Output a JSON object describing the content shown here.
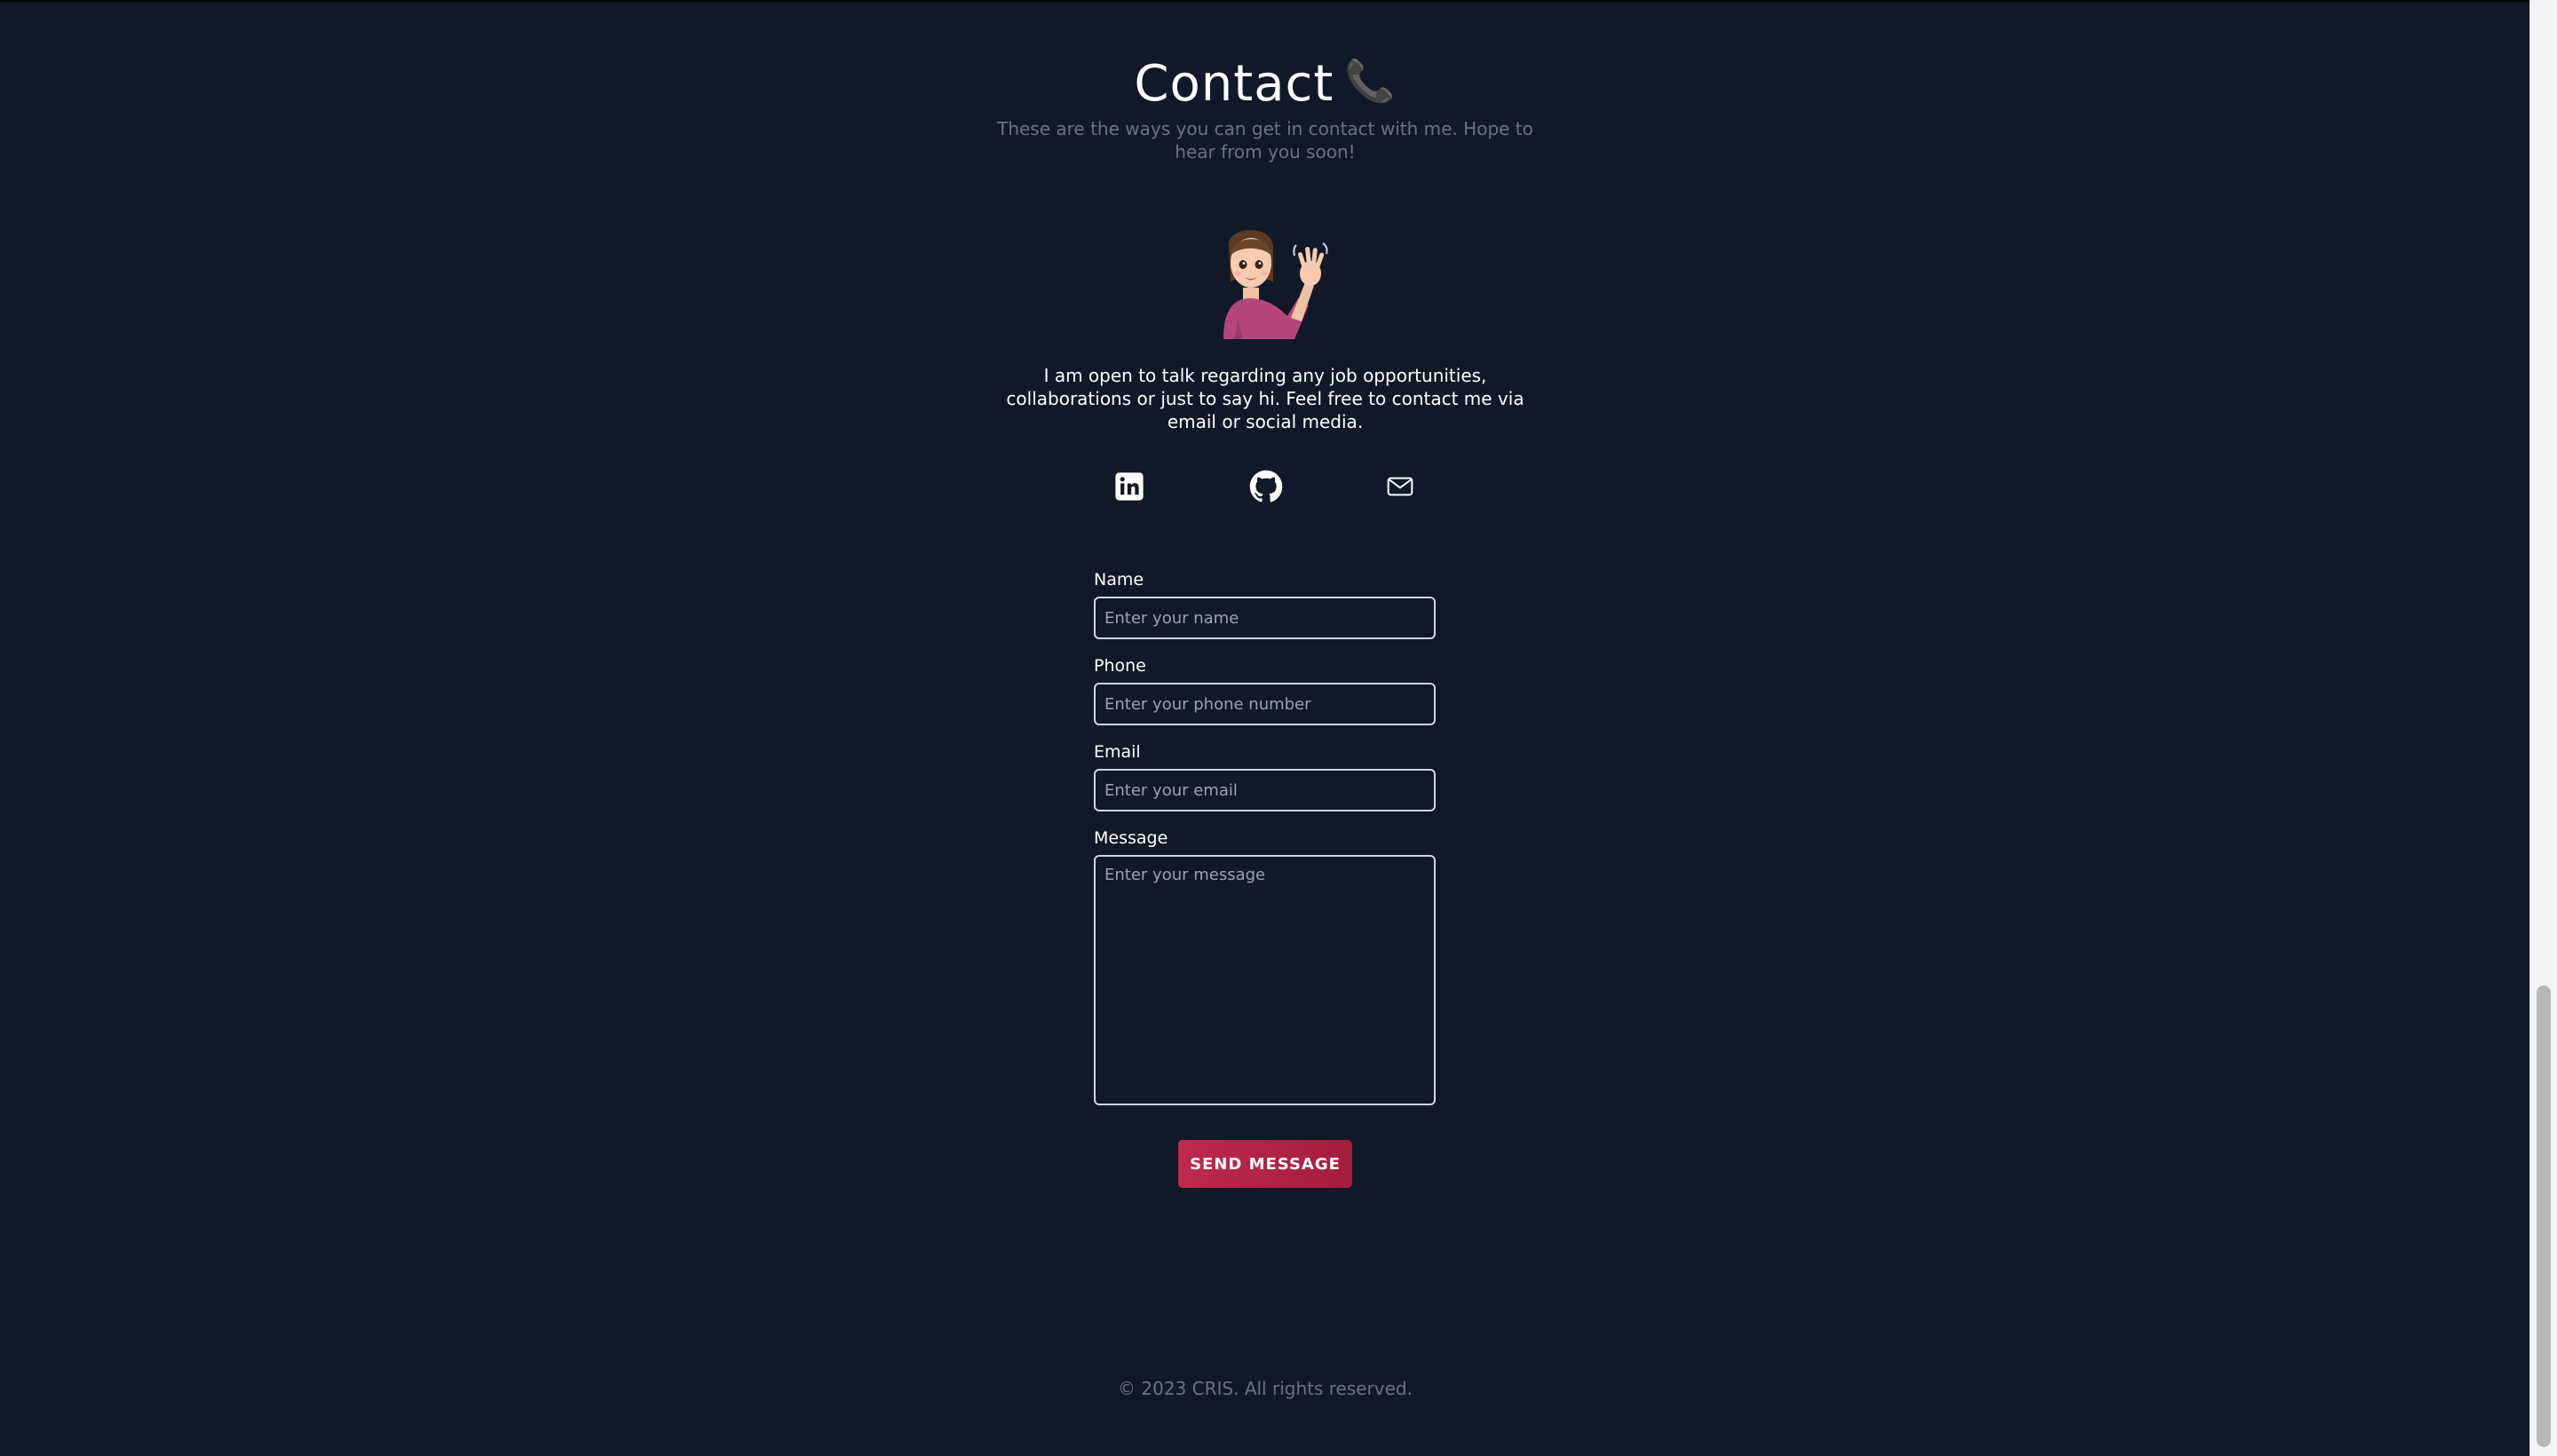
{
  "contact": {
    "title": "Contact",
    "title_icon": "telephone-receiver-icon",
    "subtitle": "These are the ways you can get in contact with me. Hope to hear from you soon!",
    "intro": "I am open to talk regarding any job opportunities, collaborations or just to say hi. Feel free to contact me via email or social media."
  },
  "social": {
    "items": [
      {
        "name": "linkedin-icon"
      },
      {
        "name": "github-icon"
      },
      {
        "name": "mail-icon"
      }
    ]
  },
  "form": {
    "name_label": "Name",
    "name_placeholder": "Enter your name",
    "phone_label": "Phone",
    "phone_placeholder": "Enter your phone number",
    "email_label": "Email",
    "email_placeholder": "Enter your email",
    "message_label": "Message",
    "message_placeholder": "Enter your message",
    "submit_label": "SEND MESSAGE"
  },
  "footer": {
    "text": "© 2023 CRIS. All rights reserved."
  },
  "colors": {
    "background": "#111827",
    "accent": "#be2a4d",
    "muted_text": "#6b7280",
    "text": "#ffffff"
  }
}
